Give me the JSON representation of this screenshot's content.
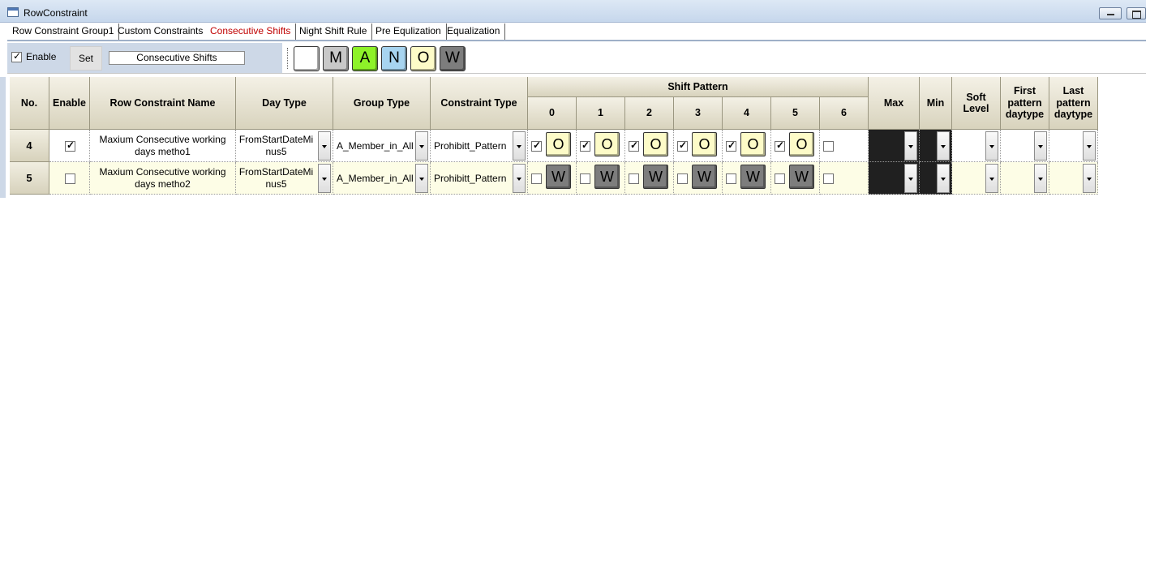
{
  "window": {
    "title": "RowConstraint"
  },
  "tabs": [
    {
      "label": "Row Constraint Group1",
      "active": false
    },
    {
      "label": "Custom Constraints",
      "active": false
    },
    {
      "label": "Consecutive Shifts",
      "active": true
    },
    {
      "label": "Night Shift Rule",
      "active": false
    },
    {
      "label": "Pre Equlization",
      "active": false
    },
    {
      "label": "Equalization",
      "active": false
    }
  ],
  "toolbar": {
    "enable_label": "Enable",
    "enable_checked": true,
    "set_label": "Set",
    "name_value": "Consecutive Shifts",
    "shift_buttons": [
      {
        "label": "",
        "color": "#ffffff"
      },
      {
        "label": "M",
        "color": "#c8c8c8"
      },
      {
        "label": "A",
        "color": "#8ef229"
      },
      {
        "label": "N",
        "color": "#a7d4f0"
      },
      {
        "label": "O",
        "color": "#fdfbc8"
      },
      {
        "label": "W",
        "color": "#7d7d7d"
      }
    ]
  },
  "grid": {
    "headers": {
      "no": "No.",
      "enable": "Enable",
      "name": "Row Constraint Name",
      "day_type": "Day Type",
      "group_type": "Group Type",
      "constraint_type": "Constraint Type",
      "shift_pattern": "Shift Pattern",
      "pattern_cols": [
        "0",
        "1",
        "2",
        "3",
        "4",
        "5",
        "6"
      ],
      "max": "Max",
      "min": "Min",
      "soft_level": "Soft Level",
      "first_pattern_daytype": "First pattern daytype",
      "last_pattern_daytype": "Last pattern daytype"
    },
    "rows": [
      {
        "no": "4",
        "enabled": true,
        "name": "Maxium Consecutive working days metho1",
        "day_type": "FromStartDateMinus5",
        "group_type": "A_Member_in_All",
        "constraint_type": "Prohibitt_Pattern",
        "pattern": [
          {
            "checked": true,
            "label": "O",
            "color": "#fdfbc8"
          },
          {
            "checked": true,
            "label": "O",
            "color": "#fdfbc8"
          },
          {
            "checked": true,
            "label": "O",
            "color": "#fdfbc8"
          },
          {
            "checked": true,
            "label": "O",
            "color": "#fdfbc8"
          },
          {
            "checked": true,
            "label": "O",
            "color": "#fdfbc8"
          },
          {
            "checked": true,
            "label": "O",
            "color": "#fdfbc8"
          },
          {
            "checked": false,
            "label": "",
            "color": ""
          }
        ],
        "row_color": "#ffffff"
      },
      {
        "no": "5",
        "enabled": false,
        "name": "Maxium Consecutive working days metho2",
        "day_type": "FromStartDateMinus5",
        "group_type": "A_Member_in_All",
        "constraint_type": "Prohibitt_Pattern",
        "pattern": [
          {
            "checked": false,
            "label": "W",
            "color": "#7d7d7d"
          },
          {
            "checked": false,
            "label": "W",
            "color": "#7d7d7d"
          },
          {
            "checked": false,
            "label": "W",
            "color": "#7d7d7d"
          },
          {
            "checked": false,
            "label": "W",
            "color": "#7d7d7d"
          },
          {
            "checked": false,
            "label": "W",
            "color": "#7d7d7d"
          },
          {
            "checked": false,
            "label": "W",
            "color": "#7d7d7d"
          },
          {
            "checked": false,
            "label": "",
            "color": ""
          }
        ],
        "row_color": "#fdfde6"
      }
    ]
  }
}
